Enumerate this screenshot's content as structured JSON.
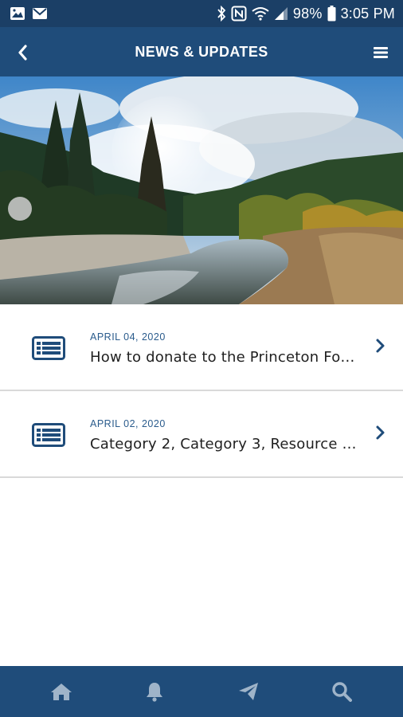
{
  "status_bar": {
    "battery": "98%",
    "time": "3:05 PM",
    "icons": [
      "image-icon",
      "mail-icon",
      "bluetooth-icon",
      "nfc-icon",
      "wifi-icon",
      "signal-icon",
      "battery-icon"
    ]
  },
  "header": {
    "title": "NEWS & UPDATES",
    "back_icon": "back-chevron-icon",
    "menu_icon": "hamburger-menu-icon"
  },
  "hero": {
    "description_icon": "landscape-photo"
  },
  "news": [
    {
      "date": "APRIL 04, 2020",
      "title": "How to donate to the Princeton Fo…",
      "icon": "newspaper-icon"
    },
    {
      "date": "APRIL 02, 2020",
      "title": "Category 2, Category 3, Resource O…",
      "icon": "newspaper-icon"
    }
  ],
  "bottom_nav": {
    "items": [
      "home-icon",
      "bell-icon",
      "send-icon",
      "search-icon"
    ]
  },
  "colors": {
    "status_bar": "#1b3f66",
    "header": "#1f4c7a",
    "accent": "#1f4c7a",
    "date_text": "#2a5b8c",
    "divider": "#d9d9d9"
  }
}
